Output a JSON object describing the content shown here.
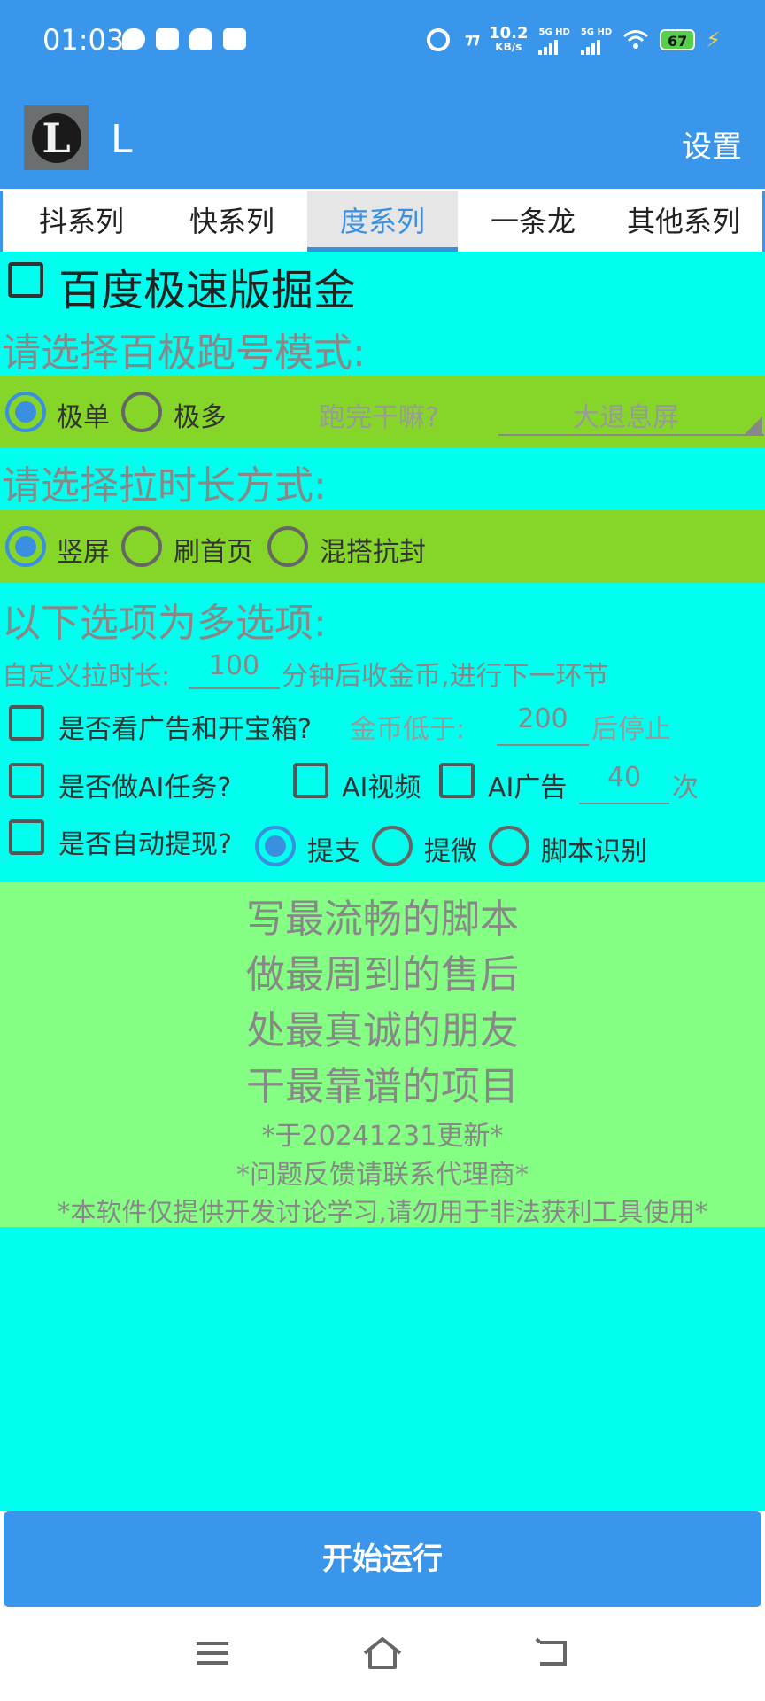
{
  "status_bar": {
    "time": "01:03",
    "net_speed_value": "10.2",
    "net_speed_unit": "KB/s",
    "sim1": "5G HD",
    "sim2": "5G HD",
    "battery": "67"
  },
  "app_bar": {
    "logo_letter": "L",
    "title": "L",
    "settings_label": "设置"
  },
  "tabs": [
    {
      "label": "抖系列",
      "active": false
    },
    {
      "label": "快系列",
      "active": false
    },
    {
      "label": "度系列",
      "active": true
    },
    {
      "label": "一条龙",
      "active": false
    },
    {
      "label": "其他系列",
      "active": false
    }
  ],
  "main": {
    "baidu_checkbox_label": "百度极速版掘金",
    "mode_heading": "请选择百极跑号模式:",
    "mode_options": [
      "极单",
      "极多"
    ],
    "mode_selected": "极单",
    "after_run_label": "跑完干嘛?",
    "after_run_value": "大退息屏",
    "duration_heading": "请选择拉时长方式:",
    "duration_options": [
      "竖屏",
      "刷首页",
      "混搭抗封"
    ],
    "duration_selected": "竖屏",
    "multi_heading": "以下选项为多选项:",
    "custom_prefix": "自定义拉时长:",
    "custom_minutes": "100",
    "custom_suffix": "分钟后收金币,进行下一环节",
    "ads_label": "是否看广告和开宝箱?",
    "coin_low_label": "金币低于:",
    "coin_low_value": "200",
    "coin_low_suffix": "后停止",
    "ai_task_label": "是否做AI任务?",
    "ai_video_label": "AI视频",
    "ai_ads_label": "AI广告",
    "ai_count": "40",
    "ai_count_unit": "次",
    "withdraw_label": "是否自动提现?",
    "withdraw_options": [
      "提支",
      "提微",
      "脚本识别"
    ],
    "withdraw_selected": "提支"
  },
  "message": {
    "lines": [
      "写最流畅的脚本",
      "做最周到的售后",
      "处最真诚的朋友",
      "干最靠谱的项目"
    ],
    "updated": "*于20241231更新*",
    "feedback": "*问题反馈请联系代理商*",
    "disclaimer": "*本软件仅提供开发讨论学习,请勿用于非法获利工具使用*"
  },
  "start_button": "开始运行",
  "colors": {
    "app_bar": "#3a96ea",
    "main_bg": "#00ffee",
    "option_band": "#86d62a",
    "message_bg": "#84ff84",
    "accent": "#3a8fe0"
  }
}
